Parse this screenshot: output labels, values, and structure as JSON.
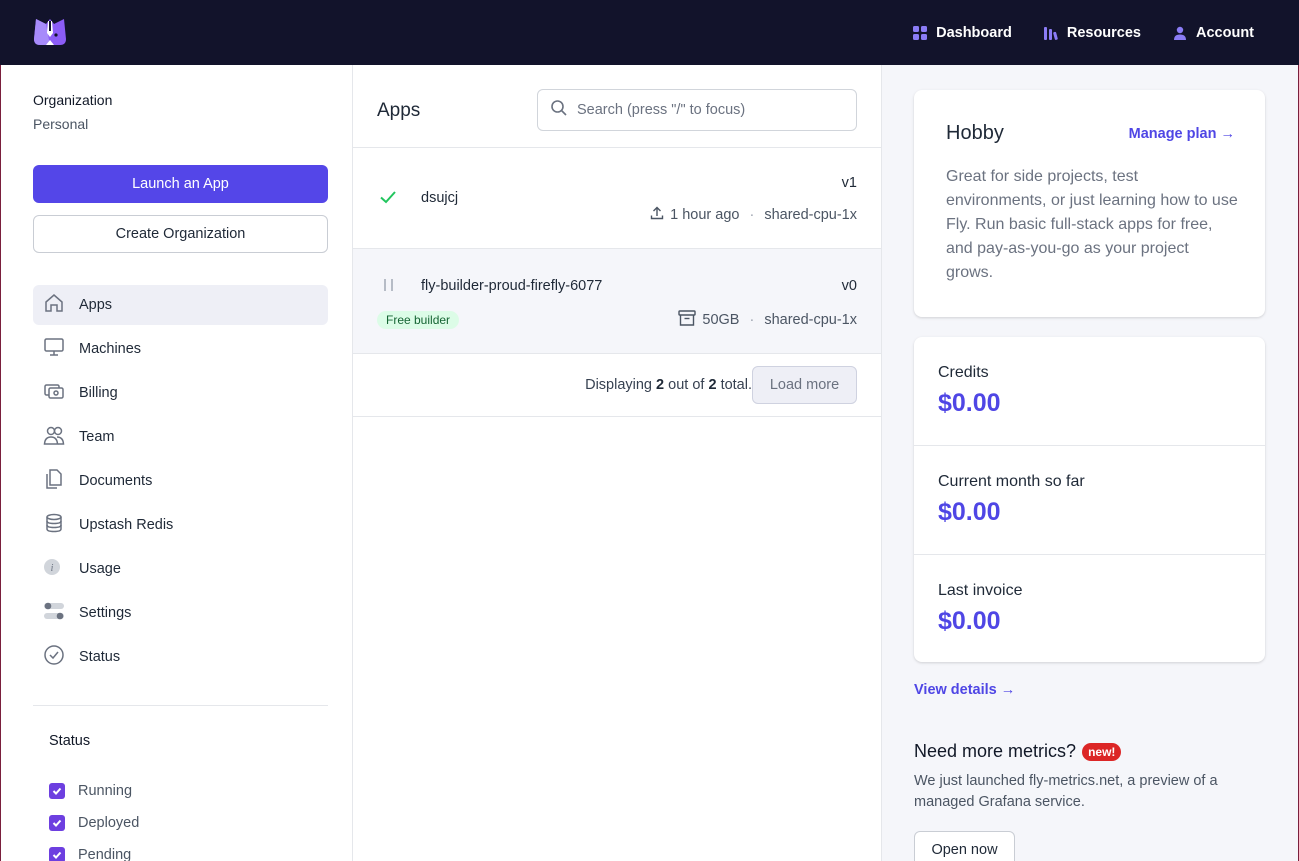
{
  "topnav": {
    "dashboard": "Dashboard",
    "resources": "Resources",
    "account": "Account"
  },
  "sidebar": {
    "org_label": "Organization",
    "org_value": "Personal",
    "launch_button": "Launch an App",
    "create_org_button": "Create Organization",
    "items": [
      {
        "label": "Apps",
        "icon": "home-icon",
        "active": true
      },
      {
        "label": "Machines",
        "icon": "monitor-icon",
        "active": false
      },
      {
        "label": "Billing",
        "icon": "money-icon",
        "active": false
      },
      {
        "label": "Team",
        "icon": "users-icon",
        "active": false
      },
      {
        "label": "Documents",
        "icon": "documents-icon",
        "active": false
      },
      {
        "label": "Upstash Redis",
        "icon": "database-icon",
        "active": false
      },
      {
        "label": "Usage",
        "icon": "info-icon",
        "active": false
      },
      {
        "label": "Settings",
        "icon": "toggles-icon",
        "active": false
      },
      {
        "label": "Status",
        "icon": "check-circle-icon",
        "active": false
      }
    ],
    "status_title": "Status",
    "status_filters": [
      {
        "label": "Running",
        "checked": true
      },
      {
        "label": "Deployed",
        "checked": true
      },
      {
        "label": "Pending",
        "checked": true
      }
    ]
  },
  "apps": {
    "title": "Apps",
    "search_placeholder": "Search (press \"/\" to focus)",
    "rows": [
      {
        "name": "dsujcj",
        "version": "v1",
        "meta_icon": "upload-icon",
        "meta_value": "1 hour ago",
        "size": "shared-cpu-1x",
        "status_icon": "check-icon"
      },
      {
        "name": "fly-builder-proud-firefly-6077",
        "version": "v0",
        "badge": "Free builder",
        "meta_icon": "archive-icon",
        "meta_value": "50GB",
        "size": "shared-cpu-1x",
        "status_icon": "pause-icon"
      }
    ],
    "displaying_prefix": "Displaying",
    "displaying_count": "2",
    "displaying_middle": "out of",
    "displaying_total": "2",
    "displaying_suffix": "total.",
    "load_more": "Load more"
  },
  "plan": {
    "name": "Hobby",
    "manage_link": "Manage plan",
    "description": "Great for side projects, test environments, or just learning how to use Fly. Run basic full-stack apps for free, and pay-as-you-go as your project grows."
  },
  "credits": [
    {
      "label": "Credits",
      "value": "$0.00"
    },
    {
      "label": "Current month so far",
      "value": "$0.00"
    },
    {
      "label": "Last invoice",
      "value": "$0.00"
    }
  ],
  "view_details": "View details",
  "metrics": {
    "title": "Need more metrics?",
    "badge": "new!",
    "description": "We just launched fly-metrics.net, a preview of a managed Grafana service.",
    "button": "Open now"
  },
  "colors": {
    "topbar": "#12132b",
    "accent": "#4f46e5",
    "primary_button": "#5446e8",
    "success": "#22c55e",
    "new_badge": "#dc2626"
  }
}
